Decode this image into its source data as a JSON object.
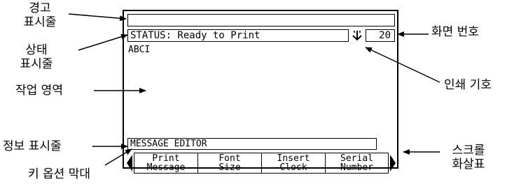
{
  "labels": {
    "warning_line": [
      "경고",
      "표시줄"
    ],
    "status_line": [
      "상태",
      "표시줄"
    ],
    "work_area": "작업 영역",
    "info_line": "정보 표시줄",
    "key_option_bar": "키 옵션 막대",
    "screen_number": "화면 번호",
    "print_symbol": "인쇄 기호",
    "scroll_arrow": [
      "스크롤",
      "화살표"
    ]
  },
  "screen": {
    "warning_text": "",
    "status_text": "STATUS: Ready to Print",
    "screen_number": "20",
    "work_text": "ABCI",
    "info_text": "MESSAGE EDITOR",
    "keys": [
      {
        "line1": "Print",
        "line2": "Message"
      },
      {
        "line1": "Font",
        "line2": "Size"
      },
      {
        "line1": "Insert",
        "line2": "Clock"
      },
      {
        "line1": "Serial",
        "line2": "Number"
      }
    ]
  }
}
